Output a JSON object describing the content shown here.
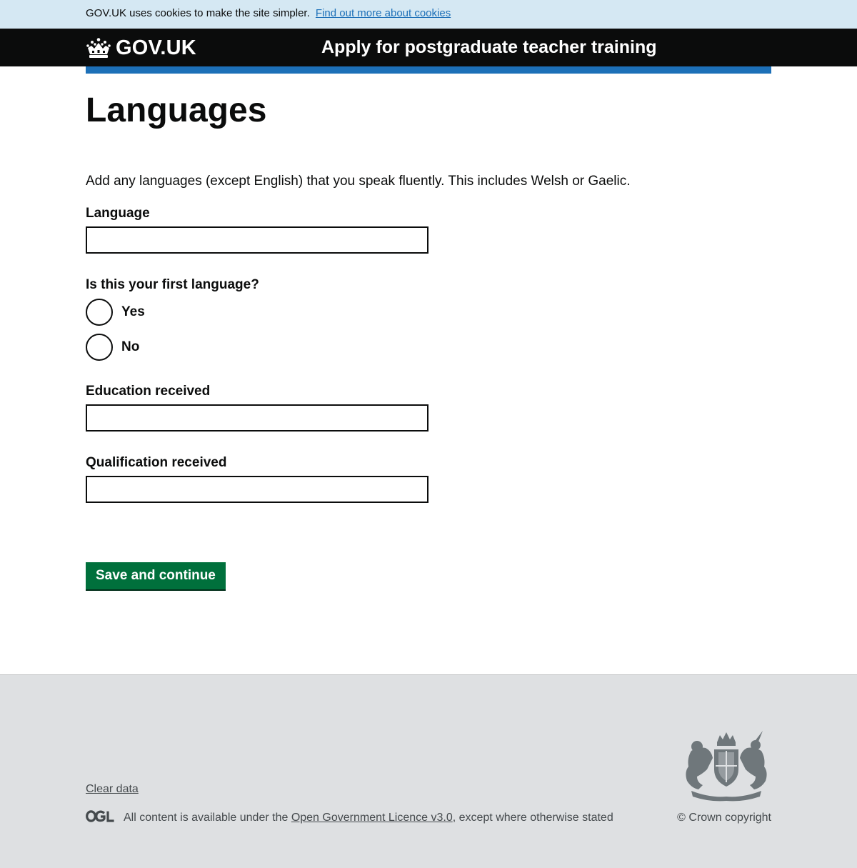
{
  "cookie_banner": {
    "text": "GOV.UK uses cookies to make the site simpler.",
    "link_label": "Find out more about cookies"
  },
  "header": {
    "logo_text": "GOV.UK",
    "logo_icon": "crown-icon",
    "service_name": "Apply for postgraduate teacher training"
  },
  "page": {
    "title": "Languages",
    "hint": "Add any languages (except English) that you speak fluently. This includes Welsh or Gaelic."
  },
  "form": {
    "language": {
      "label": "Language",
      "value": ""
    },
    "first_language": {
      "legend": "Is this your first language?",
      "options": [
        {
          "label": "Yes",
          "selected": false
        },
        {
          "label": "No",
          "selected": false
        }
      ]
    },
    "education": {
      "label": "Education received",
      "value": ""
    },
    "qualification": {
      "label": "Qualification received",
      "value": ""
    },
    "submit_label": "Save and continue"
  },
  "footer": {
    "clear_data_label": "Clear data",
    "ogl_icon": "ogl-logo-icon",
    "licence_prefix": "All content is available under the ",
    "licence_link_label": "Open Government Licence v3.0",
    "licence_suffix": ", except where otherwise stated",
    "copyright": "© Crown copyright",
    "crest_icon": "royal-coat-of-arms-icon"
  },
  "colors": {
    "header_bg": "#0b0c0c",
    "accent_blue": "#1d70b8",
    "button_green": "#00703c",
    "footer_bg": "#dee0e2",
    "cookie_bg": "#d5e8f3"
  }
}
